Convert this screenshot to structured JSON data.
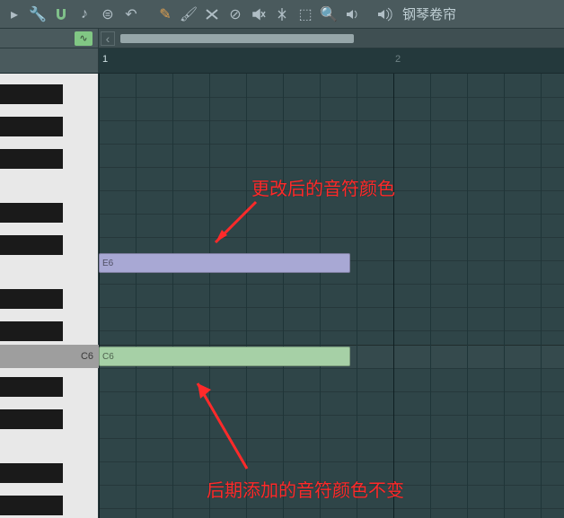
{
  "toolbar": {
    "title": "钢琴卷帘"
  },
  "ruler": {
    "bar1": "1",
    "bar2": "2"
  },
  "piano": {
    "c6_label": "C6"
  },
  "notes": {
    "e6": {
      "label": "E6",
      "color": "#a8a8d4"
    },
    "c6": {
      "label": "C6",
      "color": "#a6d0a6"
    }
  },
  "annotations": {
    "top": "更改后的音符颜色",
    "bottom": "后期添加的音符颜色不变"
  },
  "icons": {
    "arrow": "➤",
    "wrench": "🔧",
    "magnet": "∩",
    "eighth": "♪",
    "stamp": "⊜",
    "undo": "↶",
    "pencil": "✎",
    "brush": "🖌",
    "erase": "⌫",
    "noentry": "⊘",
    "mute": "🔇",
    "slice": "✂",
    "select": "⬚",
    "zoom": "🔍",
    "wave": "∿",
    "sound": "🔊",
    "back": "‹",
    "volume": "◂🔊"
  }
}
